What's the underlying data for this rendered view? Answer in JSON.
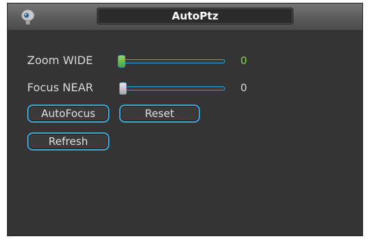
{
  "window": {
    "title": "AutoPtz",
    "icon": "camera-icon"
  },
  "zoom": {
    "label": "Zoom WIDE",
    "value": "0",
    "level": 0,
    "value_color": "#8fcf5a"
  },
  "focus": {
    "label": "Focus NEAR",
    "value": "0",
    "level": 0,
    "value_color": "#d8d8d8"
  },
  "buttons": {
    "autofocus": "AutoFocus",
    "reset": "Reset",
    "refresh": "Refresh"
  },
  "colors": {
    "accent": "#3aa6dc",
    "background": "#343434"
  }
}
